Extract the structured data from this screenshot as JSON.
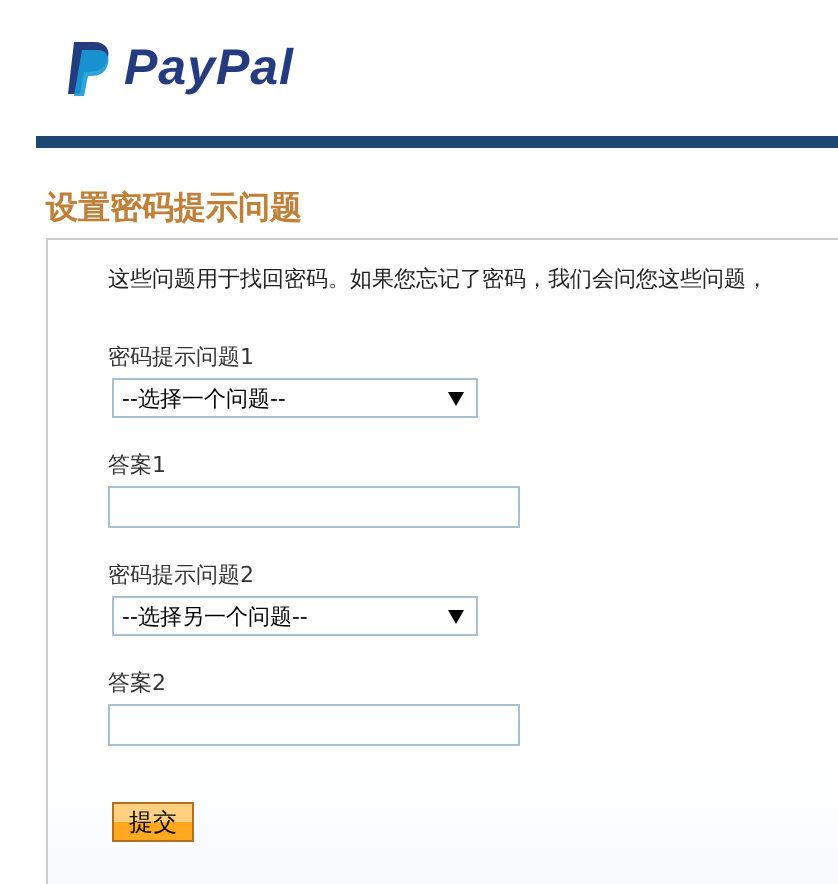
{
  "logo": {
    "text": "PayPal"
  },
  "heading": "设置密码提示问题",
  "intro": "这些问题用于找回密码。如果您忘记了密码，我们会问您这些问题，",
  "fields": [
    {
      "kind": "select",
      "label": "密码提示问题1",
      "value": "--选择一个问题--"
    },
    {
      "kind": "input",
      "label": "答案1"
    },
    {
      "kind": "select",
      "label": "密码提示问题2",
      "value": "--选择另一个问题--"
    },
    {
      "kind": "input",
      "label": "答案2"
    }
  ],
  "submit": "提交"
}
